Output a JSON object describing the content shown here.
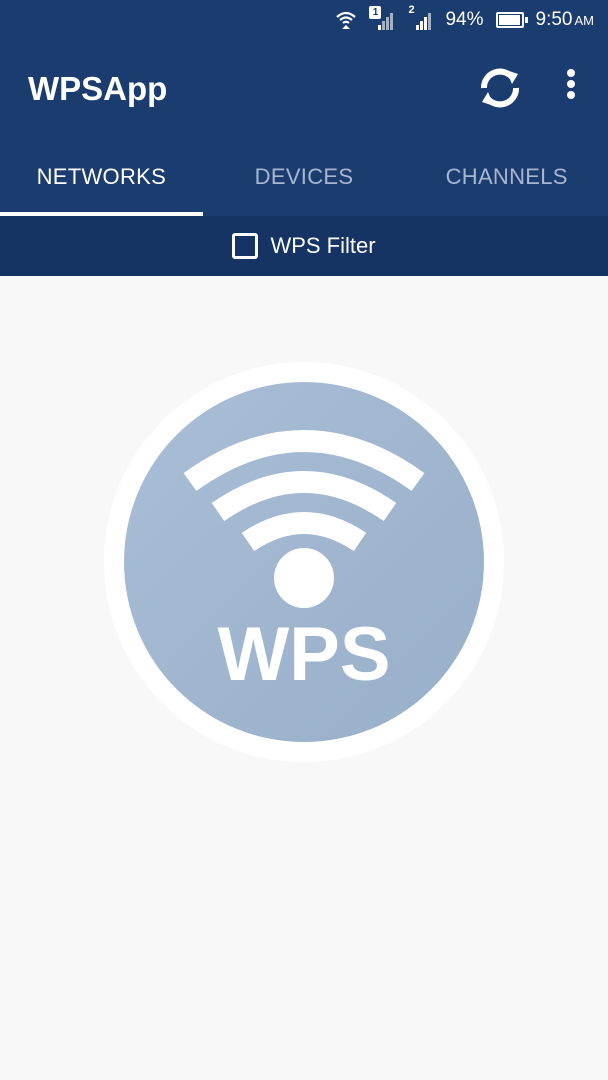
{
  "status_bar": {
    "sim1_badge": "1",
    "sim2_badge": "2",
    "battery": "94%",
    "battery_level": 0.94,
    "time": "9:50",
    "ampm": "AM"
  },
  "app_bar": {
    "title": "WPSApp",
    "refresh_icon": "refresh-icon",
    "menu_icon": "more-vert-icon"
  },
  "tabs": [
    {
      "label": "NETWORKS",
      "active": true
    },
    {
      "label": "DEVICES",
      "active": false
    },
    {
      "label": "CHANNELS",
      "active": false
    }
  ],
  "filter": {
    "label": "WPS Filter",
    "checked": false
  },
  "empty_state": {
    "logo_text": "WPS",
    "logo_icon": "wps-wifi-icon"
  },
  "colors": {
    "primary": "#1b3c6e",
    "primary_dark": "#163463",
    "tab_inactive": "#a9b6d0",
    "logo_circle": "#a0b6cf",
    "background": "#f8f8f8"
  }
}
